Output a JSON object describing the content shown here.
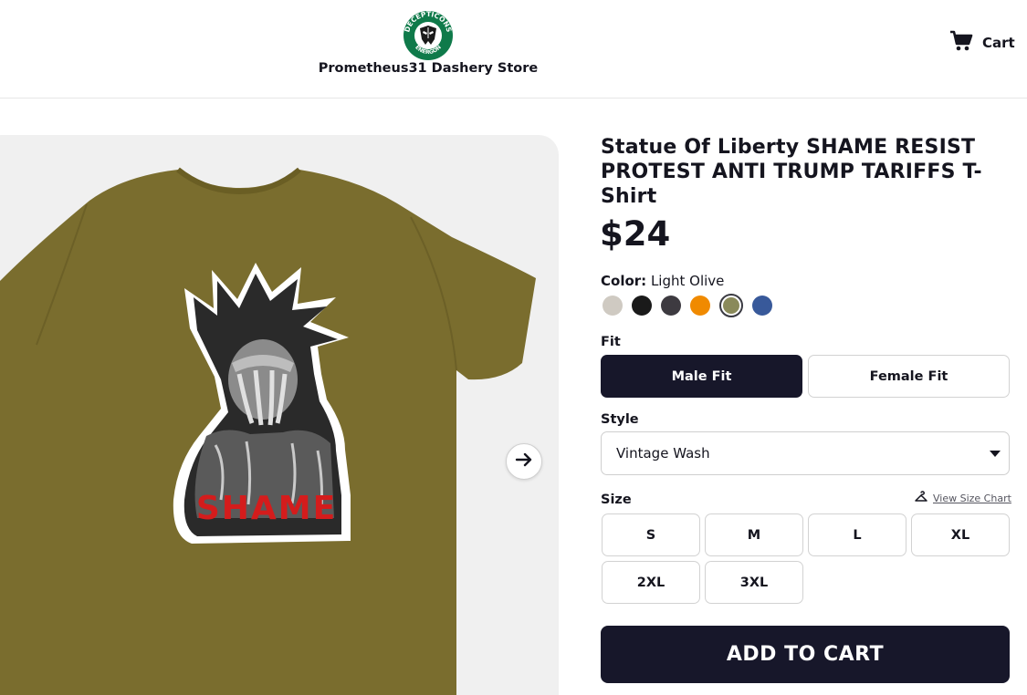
{
  "header": {
    "store_name": "Prometheus31 Dashery Store",
    "logo_text_top": "DECEPTICONS",
    "logo_text_bottom": "ENERGON",
    "cart_label": "Cart"
  },
  "product": {
    "title": "Statue Of Liberty SHAME RESIST PROTEST ANTI TRUMP TARIFFS T-Shirt",
    "price": "$24",
    "graphic_text": "SHAME",
    "color_label": "Color:",
    "color_value": "Light Olive",
    "colors": [
      {
        "name": "Light Gray",
        "hex": "#cfcac2",
        "selected": false
      },
      {
        "name": "Black",
        "hex": "#1a1a1a",
        "selected": false
      },
      {
        "name": "Charcoal",
        "hex": "#3d3a40",
        "selected": false
      },
      {
        "name": "Orange",
        "hex": "#f08a00",
        "selected": false
      },
      {
        "name": "Light Olive",
        "hex": "#8a8a5a",
        "selected": true
      },
      {
        "name": "Blue",
        "hex": "#38599a",
        "selected": false
      }
    ],
    "fit_label": "Fit",
    "fit_options": [
      "Male Fit",
      "Female Fit"
    ],
    "style_label": "Style",
    "style_value": "Vintage Wash",
    "size_label": "Size",
    "size_chart_link": "View Size Chart",
    "sizes": [
      "S",
      "M",
      "L",
      "XL",
      "2XL",
      "3XL"
    ],
    "add_to_cart": "ADD TO CART"
  },
  "colors": {
    "shirt": "#7a6d2e",
    "dark_button": "#17172a",
    "logo_green": "#0f7a4a",
    "shame_red": "#d41c1c"
  }
}
